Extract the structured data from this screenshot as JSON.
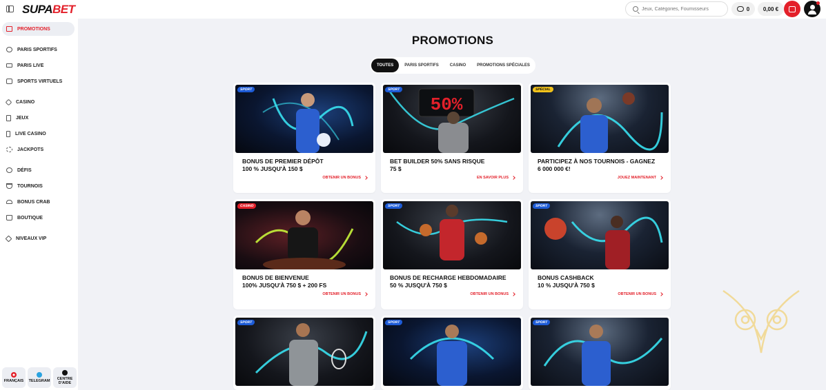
{
  "header": {
    "logo_left": "SUPA",
    "logo_right": "BET",
    "search_placeholder": "Jeux, Catégories, Fournisseurs",
    "coins_count": "0",
    "balance": "0,00 €"
  },
  "sidebar": {
    "items": [
      {
        "label": "PROMOTIONS"
      },
      {
        "label": "PARIS SPORTIFS"
      },
      {
        "label": "PARIS LIVE"
      },
      {
        "label": "SPORTS VIRTUELS"
      },
      {
        "label": "CASINO"
      },
      {
        "label": "JEUX"
      },
      {
        "label": "LIVE CASINO"
      },
      {
        "label": "JACKPOTS"
      },
      {
        "label": "DÉFIS"
      },
      {
        "label": "TOURNOIS"
      },
      {
        "label": "BONUS CRAB"
      },
      {
        "label": "BOUTIQUE"
      },
      {
        "label": "NIVEAUX VIP"
      }
    ],
    "footer": {
      "language": "FRANÇAIS",
      "telegram": "TELEGRAM",
      "help_line1": "CENTRE",
      "help_line2": "D'AIDE"
    }
  },
  "main": {
    "title": "PROMOTIONS",
    "tabs": [
      {
        "label": "TOUTES"
      },
      {
        "label": "PARIS SPORTIFS"
      },
      {
        "label": "CASINO"
      },
      {
        "label": "PROMOTIONS SPÉCIALES"
      }
    ],
    "cards": [
      {
        "badge": "SPORT",
        "title_line1": "BONUS DE PREMIER DÉPÔT",
        "title_line2": "100 % JUSQU'À 150 $",
        "cta": "OBTENIR UN BONUS"
      },
      {
        "badge": "SPORT",
        "title_line1": "BET BUILDER 50% SANS RISQUE",
        "title_line2": "75 $",
        "cta": "EN SAVOIR PLUS",
        "scoreboard": "50%"
      },
      {
        "badge": "SPÉCIAL",
        "title_line1": "PARTICIPEZ À NOS TOURNOIS - GAGNEZ",
        "title_line2": "6 000 000 €!",
        "cta": "JOUEZ MAINTENANT"
      },
      {
        "badge": "CASINO",
        "title_line1": "BONUS DE BIENVENUE",
        "title_line2": "100% JUSQU'À 750 $ + 200 FS",
        "cta": "OBTENIR UN BONUS"
      },
      {
        "badge": "SPORT",
        "title_line1": "BONUS DE RECHARGE HEBDOMADAIRE",
        "title_line2": "50 % JUSQU'À 750 $",
        "cta": "OBTENIR UN BONUS"
      },
      {
        "badge": "SPORT",
        "title_line1": "BONUS CASHBACK",
        "title_line2": "10 % JUSQU'À 750 $",
        "cta": "OBTENIR UN BONUS"
      },
      {
        "badge": "SPORT"
      },
      {
        "badge": "SPORT"
      },
      {
        "badge": "SPORT"
      }
    ]
  },
  "colors": {
    "accent_red": "#e3202a",
    "sport_badge": "#1d5bd6",
    "special_badge": "#f1c21b",
    "neon_cyan": "#39e0f0"
  }
}
